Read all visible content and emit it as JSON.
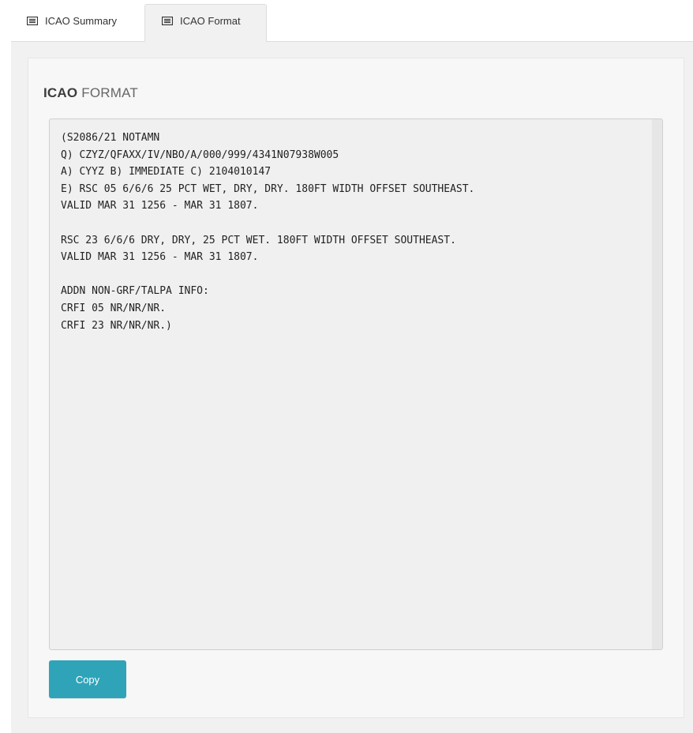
{
  "tabs": [
    {
      "label": "ICAO Summary",
      "icon": "list-icon",
      "active": false
    },
    {
      "label": "ICAO Format",
      "icon": "list-icon",
      "active": true
    }
  ],
  "panel": {
    "title_bold": "ICAO",
    "title_rest": " FORMAT",
    "notam_text": "(S2086/21 NOTAMN\nQ) CZYZ/QFAXX/IV/NBO/A/000/999/4341N07938W005\nA) CYYZ B) IMMEDIATE C) 2104010147\nE) RSC 05 6/6/6 25 PCT WET, DRY, DRY. 180FT WIDTH OFFSET SOUTHEAST.\nVALID MAR 31 1256 - MAR 31 1807.\n\nRSC 23 6/6/6 DRY, DRY, 25 PCT WET. 180FT WIDTH OFFSET SOUTHEAST.\nVALID MAR 31 1256 - MAR 31 1807.\n\nADDN NON-GRF/TALPA INFO:\nCRFI 05 NR/NR/NR.\nCRFI 23 NR/NR/NR.)",
    "copy_label": "Copy"
  },
  "colors": {
    "copy_button": "#2fa4b9",
    "panel_background": "#f7f7f7",
    "text_area_background": "#f0f0f0"
  }
}
